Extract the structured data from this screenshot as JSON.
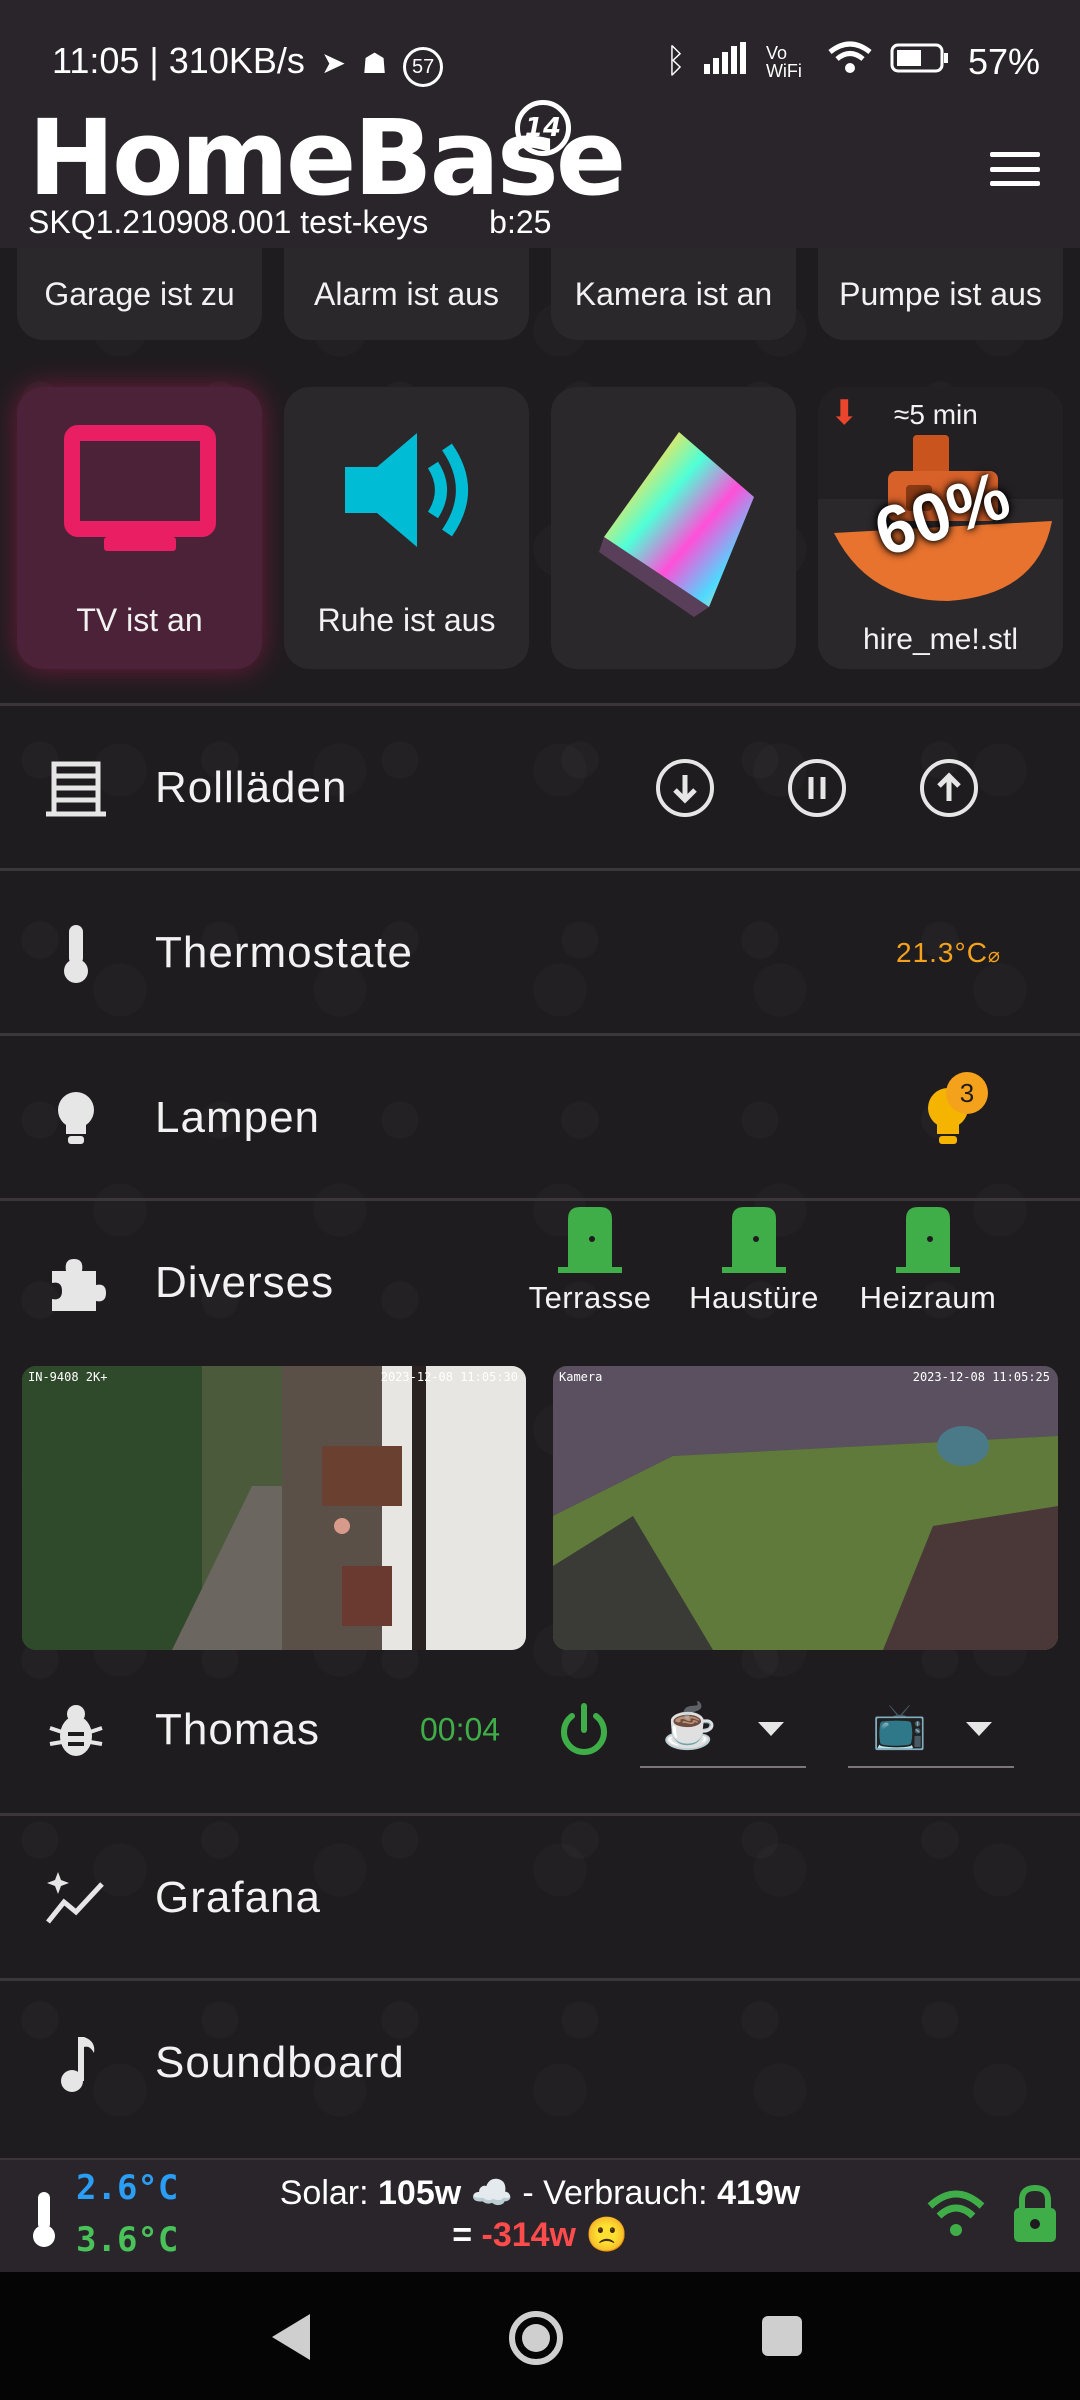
{
  "status_bar": {
    "time_speed": "11:05 | 310KB/s",
    "notif_count": "57",
    "network_label": "Vo WiFi",
    "battery": "57%"
  },
  "header": {
    "app_title": "HomeBase",
    "version_badge": "14",
    "build_id": "SKQ1.210908.001 test-keys",
    "build_number": "b:25"
  },
  "status_buttons": [
    "Garage ist zu",
    "Alarm ist aus",
    "Kamera ist an",
    "Pumpe ist aus"
  ],
  "tiles": {
    "tv_label": "TV ist an",
    "quiet_label": "Ruhe ist aus",
    "print_eta": "≈5 min",
    "print_progress": "60%",
    "print_file": "hire_me!.stl"
  },
  "sections": {
    "shutters": "Rollläden",
    "thermostats": "Thermostate",
    "thermostat_value": "21.3°C",
    "lamps": "Lampen",
    "lamps_on_count": "3",
    "misc": "Diverses",
    "doors": [
      "Terrasse",
      "Haustüre",
      "Heizraum"
    ],
    "user_name": "Thomas",
    "user_timer": "00:04",
    "grafana": "Grafana",
    "soundboard": "Soundboard"
  },
  "cameras": [
    {
      "overlay_left": "IN-9408 2K+",
      "overlay_right": "2023-12-08 11:05:30"
    },
    {
      "overlay_left": "Kamera",
      "overlay_right": "2023-12-08 11:05:25"
    }
  ],
  "bottom_bar": {
    "temp_inside": "2.6°C",
    "temp_outside": "3.6°C",
    "energy_line1_prefix": "Solar: ",
    "solar_value": "105w",
    "energy_line1_mid": " ☁️ - Verbrauch: ",
    "consumption_value": "419w",
    "energy_line2_prefix": "= ",
    "net_value": "-314w",
    "net_emoji": "🙁"
  },
  "colors": {
    "accent_pink": "#e91e63",
    "accent_cyan": "#00bcd4",
    "orange": "#f4a21b",
    "green": "#3fae49",
    "temp_blue": "#2a9df4",
    "temp_green": "#49c25a",
    "negative_red": "#ff4b4b"
  }
}
